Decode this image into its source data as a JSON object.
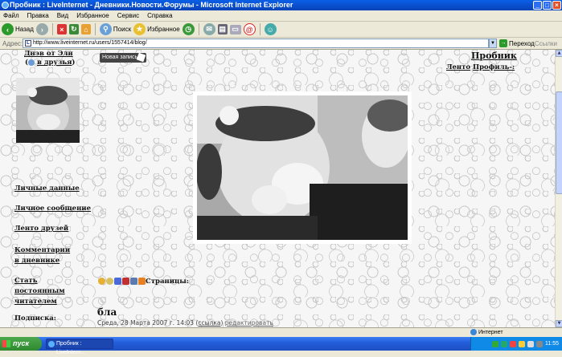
{
  "window": {
    "title": "Пробник : LiveInternet - Дневники.Новости.Форумы - Microsoft Internet Explorer",
    "controls": [
      "_",
      "□",
      "×"
    ]
  },
  "menu": [
    "Файл",
    "Правка",
    "Вид",
    "Избранное",
    "Сервис",
    "Справка"
  ],
  "toolbar": {
    "back": "Назад",
    "search": "Поиск",
    "favorites": "Избранное"
  },
  "address": {
    "label": "Адрес:",
    "url": "http://www.liveinternet.ru/users/1557414/blog/",
    "go": "Переход",
    "links": "Ссылки"
  },
  "page": {
    "diary_title": "Днэв от Элн",
    "add_friends": "в друзья",
    "new_entry": "Новая запись",
    "blog_name": "Пробник",
    "nav": [
      "Ленто",
      "Профиль-:"
    ],
    "sidebar_links": [
      "Личные данные",
      "Личное сообщение",
      "Ленто друзей",
      "Комментарии в дневнике",
      "Стать постоянным читателем"
    ],
    "subscribe": "Подписка:",
    "pages_label": "Страницы:",
    "post_title": "бла",
    "post_date": "Среда, 28 Марта 2007 г. 14:03",
    "post_link": "ссылка",
    "post_edit": "редактировать"
  },
  "status": {
    "zone": "Интернет"
  },
  "taskbar": {
    "start": "пуск",
    "task": "Пробник : LiveIntern...",
    "clock": "11:55"
  }
}
